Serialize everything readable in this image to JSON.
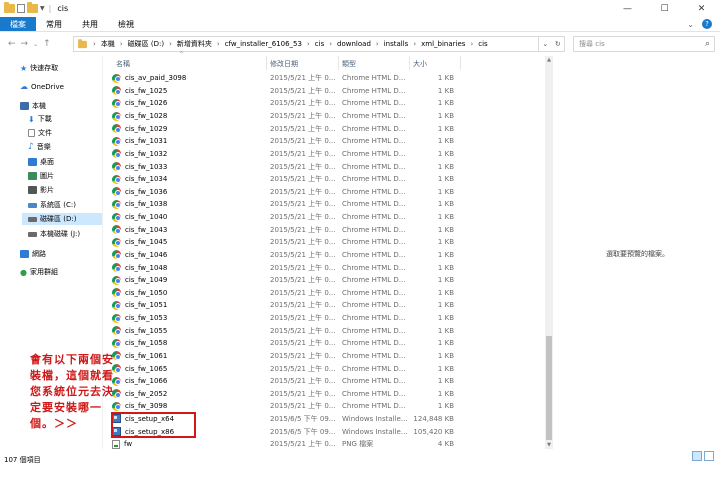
{
  "window": {
    "title": "cis",
    "minimize": "—",
    "maximize": "☐",
    "close": "✕"
  },
  "ribbon": {
    "tabs": [
      "檔案",
      "常用",
      "共用",
      "檢視"
    ]
  },
  "addressbar": {
    "crumbs": [
      "本機",
      "磁碟區 (D:)",
      "新增資料夾",
      "cfw_installer_6106_53",
      "cis",
      "download",
      "installs",
      "xml_binaries",
      "cis"
    ],
    "search_placeholder": "搜尋 cis"
  },
  "nav": {
    "items": [
      {
        "label": "快速存取",
        "icon": "star-icon",
        "color": "#2f7bd6"
      },
      {
        "label": "OneDrive",
        "icon": "cloud-icon",
        "color": "#2f7bd6"
      },
      {
        "label": "本機",
        "icon": "computer-icon",
        "color": "#3b6ea8"
      },
      {
        "label": "下載",
        "icon": "download-icon",
        "color": "#2f7bd6"
      },
      {
        "label": "文件",
        "icon": "document-icon",
        "color": "#8a8a8a"
      },
      {
        "label": "音樂",
        "icon": "music-icon",
        "color": "#2f7bd6"
      },
      {
        "label": "桌面",
        "icon": "desktop-icon",
        "color": "#2f7bd6"
      },
      {
        "label": "圖片",
        "icon": "picture-icon",
        "color": "#3b8c5a"
      },
      {
        "label": "影片",
        "icon": "video-icon",
        "color": "#555555"
      },
      {
        "label": "系統區 (C:)",
        "icon": "drive-icon",
        "color": "#4a88c7"
      },
      {
        "label": "磁碟區 (D:)",
        "icon": "drive-icon",
        "color": "#6a6a6a"
      },
      {
        "label": "本機磁碟 (J:)",
        "icon": "drive-icon",
        "color": "#6a6a6a"
      },
      {
        "label": "網路",
        "icon": "network-icon",
        "color": "#2f7bd6"
      },
      {
        "label": "家用群組",
        "icon": "homegroup-icon",
        "color": "#2f9d4a"
      }
    ]
  },
  "columns": {
    "name": "名稱",
    "date": "修改日期",
    "type": "類型",
    "size": "大小"
  },
  "files": [
    {
      "name": "cis_av_paid_3098",
      "date": "2015/5/21 上午 0...",
      "type": "Chrome HTML D...",
      "size": "1 KB",
      "icon": "chrome"
    },
    {
      "name": "cis_fw_1025",
      "date": "2015/5/21 上午 0...",
      "type": "Chrome HTML D...",
      "size": "1 KB",
      "icon": "chrome"
    },
    {
      "name": "cis_fw_1026",
      "date": "2015/5/21 上午 0...",
      "type": "Chrome HTML D...",
      "size": "1 KB",
      "icon": "chrome"
    },
    {
      "name": "cis_fw_1028",
      "date": "2015/5/21 上午 0...",
      "type": "Chrome HTML D...",
      "size": "1 KB",
      "icon": "chrome"
    },
    {
      "name": "cis_fw_1029",
      "date": "2015/5/21 上午 0...",
      "type": "Chrome HTML D...",
      "size": "1 KB",
      "icon": "chrome"
    },
    {
      "name": "cis_fw_1031",
      "date": "2015/5/21 上午 0...",
      "type": "Chrome HTML D...",
      "size": "1 KB",
      "icon": "chrome"
    },
    {
      "name": "cis_fw_1032",
      "date": "2015/5/21 上午 0...",
      "type": "Chrome HTML D...",
      "size": "1 KB",
      "icon": "chrome"
    },
    {
      "name": "cis_fw_1033",
      "date": "2015/5/21 上午 0...",
      "type": "Chrome HTML D...",
      "size": "1 KB",
      "icon": "chrome"
    },
    {
      "name": "cis_fw_1034",
      "date": "2015/5/21 上午 0...",
      "type": "Chrome HTML D...",
      "size": "1 KB",
      "icon": "chrome"
    },
    {
      "name": "cis_fw_1036",
      "date": "2015/5/21 上午 0...",
      "type": "Chrome HTML D...",
      "size": "1 KB",
      "icon": "chrome"
    },
    {
      "name": "cis_fw_1038",
      "date": "2015/5/21 上午 0...",
      "type": "Chrome HTML D...",
      "size": "1 KB",
      "icon": "chrome"
    },
    {
      "name": "cis_fw_1040",
      "date": "2015/5/21 上午 0...",
      "type": "Chrome HTML D...",
      "size": "1 KB",
      "icon": "chrome"
    },
    {
      "name": "cis_fw_1043",
      "date": "2015/5/21 上午 0...",
      "type": "Chrome HTML D...",
      "size": "1 KB",
      "icon": "chrome"
    },
    {
      "name": "cis_fw_1045",
      "date": "2015/5/21 上午 0...",
      "type": "Chrome HTML D...",
      "size": "1 KB",
      "icon": "chrome"
    },
    {
      "name": "cis_fw_1046",
      "date": "2015/5/21 上午 0...",
      "type": "Chrome HTML D...",
      "size": "1 KB",
      "icon": "chrome"
    },
    {
      "name": "cis_fw_1048",
      "date": "2015/5/21 上午 0...",
      "type": "Chrome HTML D...",
      "size": "1 KB",
      "icon": "chrome"
    },
    {
      "name": "cis_fw_1049",
      "date": "2015/5/21 上午 0...",
      "type": "Chrome HTML D...",
      "size": "1 KB",
      "icon": "chrome"
    },
    {
      "name": "cis_fw_1050",
      "date": "2015/5/21 上午 0...",
      "type": "Chrome HTML D...",
      "size": "1 KB",
      "icon": "chrome"
    },
    {
      "name": "cis_fw_1051",
      "date": "2015/5/21 上午 0...",
      "type": "Chrome HTML D...",
      "size": "1 KB",
      "icon": "chrome"
    },
    {
      "name": "cis_fw_1053",
      "date": "2015/5/21 上午 0...",
      "type": "Chrome HTML D...",
      "size": "1 KB",
      "icon": "chrome"
    },
    {
      "name": "cis_fw_1055",
      "date": "2015/5/21 上午 0...",
      "type": "Chrome HTML D...",
      "size": "1 KB",
      "icon": "chrome"
    },
    {
      "name": "cis_fw_1058",
      "date": "2015/5/21 上午 0...",
      "type": "Chrome HTML D...",
      "size": "1 KB",
      "icon": "chrome"
    },
    {
      "name": "cis_fw_1061",
      "date": "2015/5/21 上午 0...",
      "type": "Chrome HTML D...",
      "size": "1 KB",
      "icon": "chrome"
    },
    {
      "name": "cis_fw_1065",
      "date": "2015/5/21 上午 0...",
      "type": "Chrome HTML D...",
      "size": "1 KB",
      "icon": "chrome"
    },
    {
      "name": "cis_fw_1066",
      "date": "2015/5/21 上午 0...",
      "type": "Chrome HTML D...",
      "size": "1 KB",
      "icon": "chrome"
    },
    {
      "name": "cis_fw_2052",
      "date": "2015/5/21 上午 0...",
      "type": "Chrome HTML D...",
      "size": "1 KB",
      "icon": "chrome"
    },
    {
      "name": "cis_fw_3098",
      "date": "2015/5/21 上午 0...",
      "type": "Chrome HTML D...",
      "size": "1 KB",
      "icon": "chrome"
    },
    {
      "name": "cis_setup_x64",
      "date": "2015/6/5 下午 09...",
      "type": "Windows Installe...",
      "size": "124,848 KB",
      "icon": "msi"
    },
    {
      "name": "cis_setup_x86",
      "date": "2015/6/5 下午 09...",
      "type": "Windows Installe...",
      "size": "105,420 KB",
      "icon": "msi"
    },
    {
      "name": "fw",
      "date": "2015/5/21 上午 0...",
      "type": "PNG 檔案",
      "size": "4 KB",
      "icon": "png"
    }
  ],
  "preview_message": "選取要預覽的檔案。",
  "status": {
    "item_count": "107 個項目"
  },
  "annotation": {
    "text": "會有以下兩個安裝檔，這個就看您系統位元去決定要安裝哪一個。＞＞",
    "color": "#d01818"
  },
  "colors": {
    "accent": "#1979ca",
    "selection": "#cce8ff",
    "annotation": "#d01818"
  }
}
